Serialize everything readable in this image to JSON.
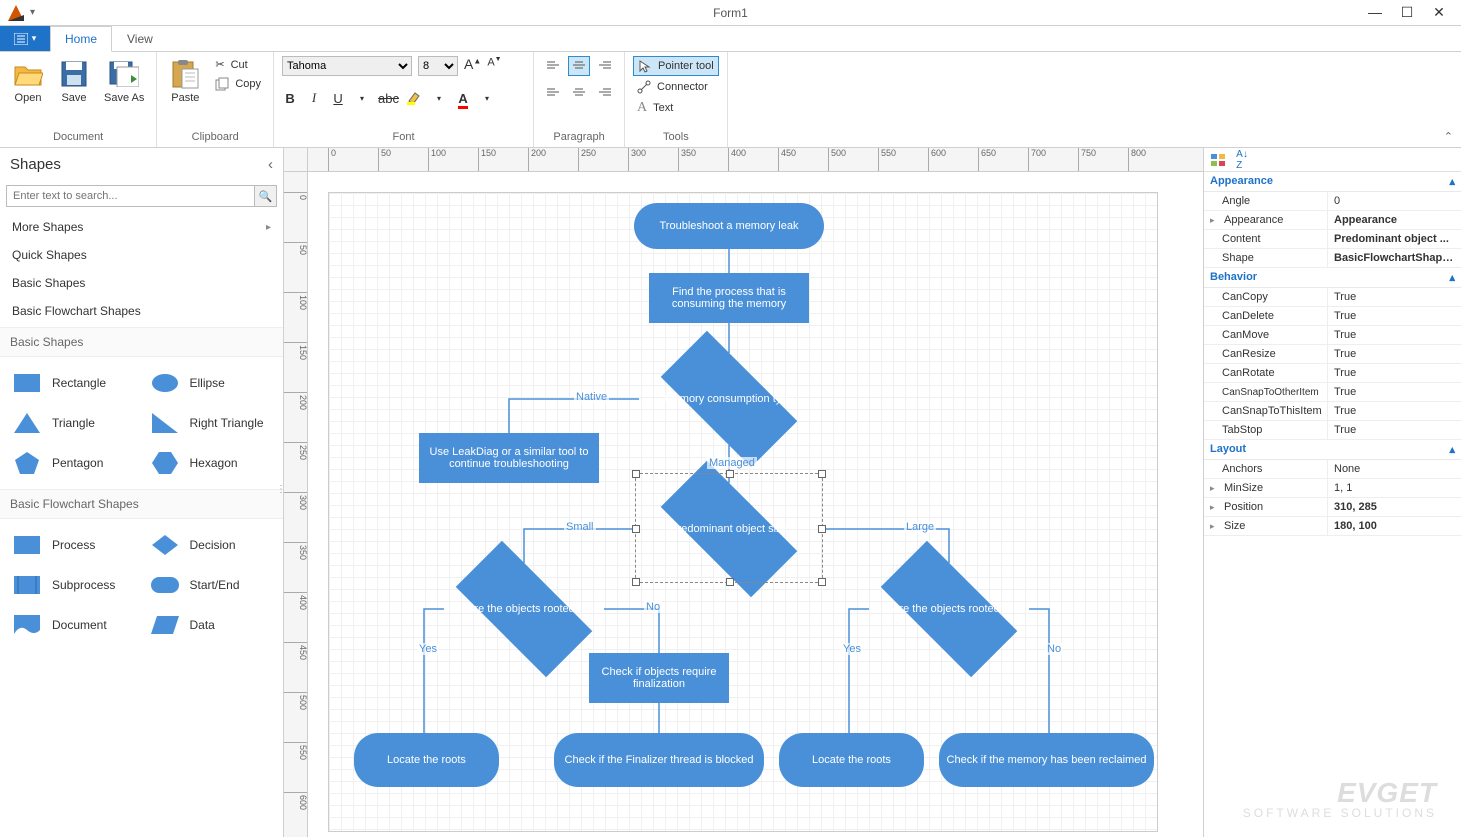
{
  "window": {
    "title": "Form1"
  },
  "tabs": {
    "home": "Home",
    "view": "View"
  },
  "ribbon": {
    "document": {
      "label": "Document",
      "open": "Open",
      "save": "Save",
      "saveas": "Save As"
    },
    "clipboard": {
      "label": "Clipboard",
      "paste": "Paste",
      "cut": "Cut",
      "copy": "Copy"
    },
    "font": {
      "label": "Font",
      "name": "Tahoma",
      "size": "8"
    },
    "paragraph": {
      "label": "Paragraph"
    },
    "tools": {
      "label": "Tools",
      "pointer": "Pointer tool",
      "connector": "Connector",
      "text": "Text"
    }
  },
  "shapes_panel": {
    "title": "Shapes",
    "search_placeholder": "Enter text to search...",
    "categories": [
      "More Shapes",
      "Quick Shapes",
      "Basic Shapes",
      "Basic Flowchart Shapes"
    ],
    "basic_header": "Basic Shapes",
    "basic": [
      "Rectangle",
      "Ellipse",
      "Triangle",
      "Right Triangle",
      "Pentagon",
      "Hexagon"
    ],
    "flow_header": "Basic Flowchart Shapes",
    "flow": [
      "Process",
      "Decision",
      "Subprocess",
      "Start/End",
      "Document",
      "Data"
    ]
  },
  "ruler_h": [
    "0",
    "50",
    "100",
    "150",
    "200",
    "250",
    "300",
    "350",
    "400",
    "450",
    "500",
    "550",
    "600",
    "650",
    "700",
    "750",
    "800"
  ],
  "ruler_v": [
    "0",
    "50",
    "100",
    "150",
    "200",
    "250",
    "300",
    "350",
    "400",
    "450",
    "500",
    "550",
    "600"
  ],
  "flowchart": {
    "n1": "Troubleshoot a memory leak",
    "n2": "Find the process that is consuming the memory",
    "n3": "Memory consumption type",
    "n4": "Use LeakDiag or a similar tool to continue troubleshooting",
    "n5": "Predominant object size",
    "n6": "Are the objects rooted?",
    "n7": "Are the objects rooted?",
    "n8": "Check if objects require finalization",
    "n9": "Locate the roots",
    "n10": "Check if the Finalizer thread is blocked",
    "n11": "Locate the roots",
    "n12": "Check if the memory has been reclaimed",
    "l_native": "Native",
    "l_managed": "Managed",
    "l_small": "Small",
    "l_large": "Large",
    "l_yes": "Yes",
    "l_no": "No"
  },
  "properties": {
    "cat_appearance": "Appearance",
    "angle": {
      "name": "Angle",
      "value": "0"
    },
    "appearance": {
      "name": "Appearance",
      "value": "Appearance"
    },
    "content": {
      "name": "Content",
      "value": "Predominant object ..."
    },
    "shape": {
      "name": "Shape",
      "value": "BasicFlowchartShape..."
    },
    "cat_behavior": "Behavior",
    "cancopy": {
      "name": "CanCopy",
      "value": "True"
    },
    "candelete": {
      "name": "CanDelete",
      "value": "True"
    },
    "canmove": {
      "name": "CanMove",
      "value": "True"
    },
    "canresize": {
      "name": "CanResize",
      "value": "True"
    },
    "canrotate": {
      "name": "CanRotate",
      "value": "True"
    },
    "cansnapother": {
      "name": "CanSnapToOtherItem",
      "value": "True"
    },
    "cansnapthis": {
      "name": "CanSnapToThisItem",
      "value": "True"
    },
    "tabstop": {
      "name": "TabStop",
      "value": "True"
    },
    "cat_layout": "Layout",
    "anchors": {
      "name": "Anchors",
      "value": "None"
    },
    "minsize": {
      "name": "MinSize",
      "value": "1, 1"
    },
    "position": {
      "name": "Position",
      "value": "310, 285"
    },
    "size": {
      "name": "Size",
      "value": "180, 100"
    }
  },
  "watermark": {
    "main": "EVGET",
    "sub": "SOFTWARE SOLUTIONS"
  }
}
